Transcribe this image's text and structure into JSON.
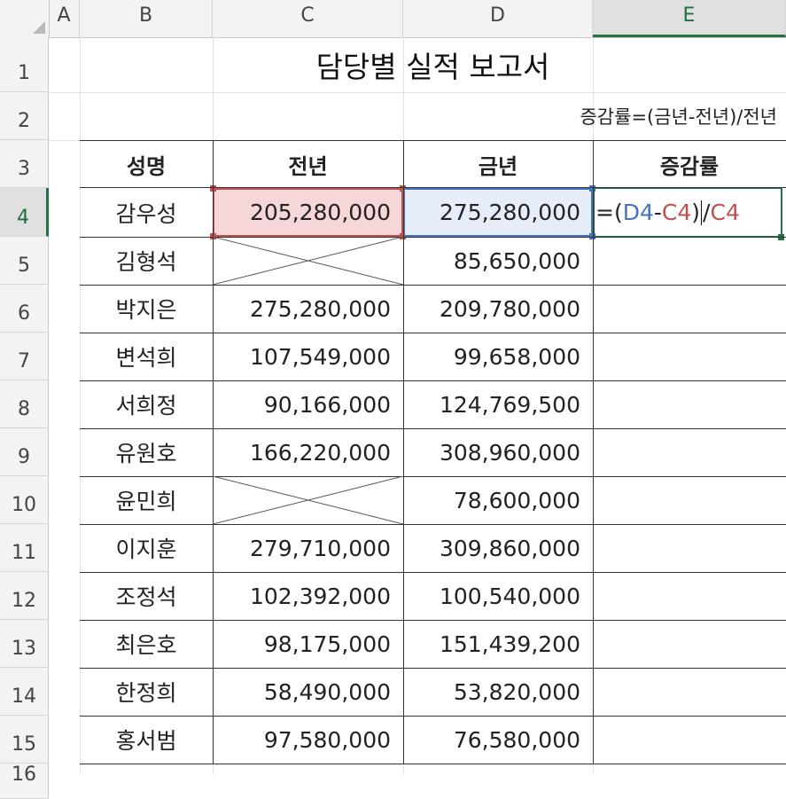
{
  "columns": [
    "A",
    "B",
    "C",
    "D",
    "E"
  ],
  "active_column": "E",
  "rows": [
    "1",
    "2",
    "3",
    "4",
    "5",
    "6",
    "7",
    "8",
    "9",
    "10",
    "11",
    "12",
    "13",
    "14",
    "15",
    "16"
  ],
  "active_row": "4",
  "title": "담당별 실적 보고서",
  "note": "증감률=(금년-전년)/전년",
  "headers": {
    "name": "성명",
    "prev": "전년",
    "curr": "금년",
    "rate": "증감률"
  },
  "records": [
    {
      "name": "감우성",
      "prev": "205,280,000",
      "curr": "275,280,000"
    },
    {
      "name": "김형석",
      "prev": "",
      "curr": "85,650,000"
    },
    {
      "name": "박지은",
      "prev": "275,280,000",
      "curr": "209,780,000"
    },
    {
      "name": "변석희",
      "prev": "107,549,000",
      "curr": "99,658,000"
    },
    {
      "name": "서희정",
      "prev": "90,166,000",
      "curr": "124,769,500"
    },
    {
      "name": "유원호",
      "prev": "166,220,000",
      "curr": "308,960,000"
    },
    {
      "name": "윤민희",
      "prev": "",
      "curr": "78,600,000"
    },
    {
      "name": "이지훈",
      "prev": "279,710,000",
      "curr": "309,860,000"
    },
    {
      "name": "조정석",
      "prev": "102,392,000",
      "curr": "100,540,000"
    },
    {
      "name": "최은호",
      "prev": "98,175,000",
      "curr": "151,439,200"
    },
    {
      "name": "한정희",
      "prev": "58,490,000",
      "curr": "53,820,000"
    },
    {
      "name": "홍서범",
      "prev": "97,580,000",
      "curr": "76,580,000"
    }
  ],
  "formula": {
    "eq": "=",
    "open": "(",
    "ref1": "D4",
    "minus": "-",
    "ref2": "C4",
    "close": ")",
    "slash": "/",
    "ref3": "C4"
  },
  "colors": {
    "selection_green": "#217346",
    "ref_red": "#c0504d",
    "ref_blue": "#4472c4"
  }
}
